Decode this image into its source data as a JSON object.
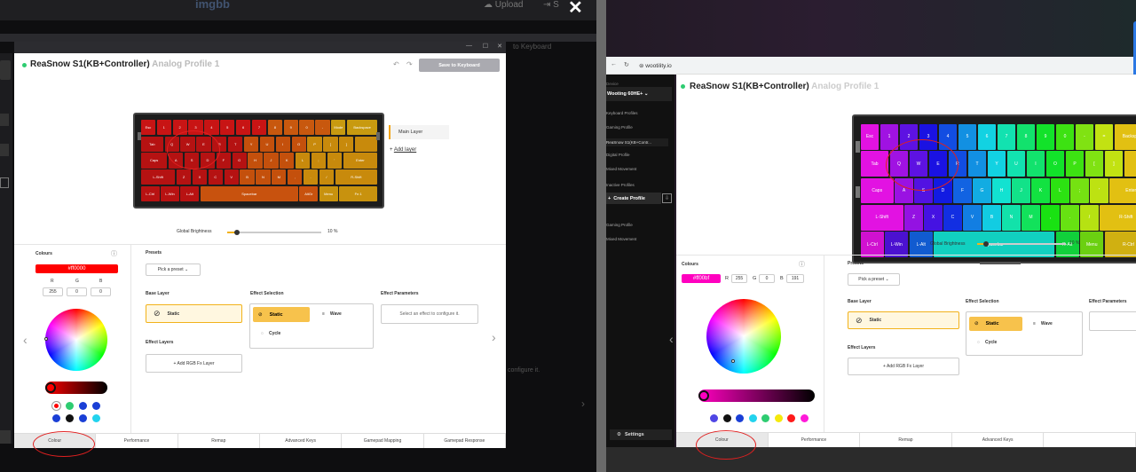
{
  "left": {
    "behind": {
      "logo": "imgbb",
      "upload": "Upload",
      "toKeyboard": "to Keyboard",
      "configure": "configure it."
    },
    "close_glyph": "✕",
    "window_controls": [
      "—",
      "☐",
      "✕"
    ],
    "header": {
      "device": "ReaSnow S1(KB+Controller)",
      "profile": "Analog Profile 1",
      "save_label": "Save to Keyboard"
    },
    "layers": {
      "main": "Main Layer",
      "add": "Add layer"
    },
    "brightness": {
      "label": "Global Brightness",
      "value": "10 %",
      "fraction": 0.1
    },
    "colours": {
      "title": "Colours",
      "hex": "#ff0000",
      "r_label": "R",
      "g_label": "G",
      "b_label": "B",
      "r": "255",
      "g": "0",
      "b": "0",
      "accent": "#ff0000"
    },
    "presets": {
      "title": "Presets",
      "pick": "Pick a preset"
    },
    "base_layer": {
      "title": "Base Layer",
      "static": "Static"
    },
    "effect_selection": {
      "title": "Effect Selection",
      "static": "Static",
      "wave": "Wave",
      "cycle": "Cycle"
    },
    "effect_parameters": {
      "title": "Effect Parameters",
      "hint": "Select an effect to configure it."
    },
    "effect_layers": {
      "title": "Effect Layers",
      "add": "+ Add RGB Fx Layer"
    },
    "tabs": [
      "Colour",
      "Performance",
      "Remap",
      "Advanced Keys",
      "Gamepad Mapping",
      "Gamepad Response"
    ],
    "swatches": [
      "#ff0000",
      "#2ecc71",
      "#1a3fd6",
      "#1a3fd6",
      "#1a3fd6",
      "#111111",
      "#1a3fd6",
      "#22d3ee"
    ],
    "keyboard": {
      "rows": [
        [
          "Esc",
          "1",
          "2",
          "3",
          "4",
          "5",
          "6",
          "7",
          "8",
          "9",
          "0",
          "-",
          "Mode",
          "Backspace"
        ],
        [
          "Tab",
          "Q",
          "W",
          "E",
          "R",
          "T",
          "Y",
          "U",
          "I",
          "O",
          "P",
          "[",
          "]",
          ""
        ],
        [
          "Caps",
          "A",
          "S",
          "D",
          "F",
          "G",
          "H",
          "J",
          "K",
          "L",
          ";",
          "'",
          "Enter"
        ],
        [
          "L-Shift",
          "Z",
          "X",
          "C",
          "V",
          "B",
          "N",
          "M",
          ",",
          ".",
          "/",
          "R-Shift"
        ],
        [
          "L-Ctrl",
          "L-Win",
          "L-Alt",
          "Spacebar",
          "AltGr",
          "Menu",
          "Fn 1"
        ]
      ]
    }
  },
  "right": {
    "url": "wootility.io",
    "header": {
      "device": "ReaSnow S1(KB+Controller)",
      "profile": "Analog Profile 1"
    },
    "sidebar": {
      "device": "Wooting 60HE+",
      "items": [
        "Keyboard Profiles",
        "Gaming Profile",
        "ReaSnow S1(KB+Contr...",
        "Digital Profile",
        "Mixed Movement",
        "Inactive Profiles",
        "Gaming Profile",
        "Mixed Movement"
      ],
      "create": "Create Profile",
      "settings": "Settings",
      "device_label": "Device"
    },
    "brightness": {
      "label": "Global Brightness",
      "value": "10 %",
      "fraction": 0.1
    },
    "colours": {
      "title": "Colours",
      "hex": "#ff00bf",
      "r_label": "R",
      "g_label": "G",
      "b_label": "B",
      "r": "255",
      "g": "0",
      "b": "191",
      "accent": "#ff00bf"
    },
    "presets": {
      "title": "Presets",
      "pick": "Pick a preset"
    },
    "base_layer": {
      "title": "Base Layer",
      "static": "Static"
    },
    "effect_selection": {
      "title": "Effect Selection",
      "static": "Static",
      "wave": "Wave",
      "cycle": "Cycle"
    },
    "effect_parameters": {
      "title": "Effect Parameters"
    },
    "effect_layers": {
      "title": "Effect Layers",
      "add": "+ Add RGB Fx Layer"
    },
    "tabs": [
      "Colour",
      "Performance",
      "Remap",
      "Advanced Keys",
      ""
    ],
    "swatches": [
      "#4f46e5",
      "#111111",
      "#1a3fd6",
      "#22d3ee",
      "#2ecc71",
      "#f5e90c",
      "#ff1a1a",
      "#ff1ad9"
    ],
    "keyboard": {
      "rows": [
        [
          "Esc",
          "1",
          "2",
          "3",
          "4",
          "5",
          "6",
          "7",
          "8",
          "9",
          "0",
          "-",
          "=",
          "Backspace"
        ],
        [
          "Tab",
          "Q",
          "W",
          "E",
          "R",
          "T",
          "Y",
          "U",
          "I",
          "O",
          "P",
          "[",
          "]",
          "\\"
        ],
        [
          "Caps",
          "A",
          "S",
          "D",
          "F",
          "G",
          "H",
          "J",
          "K",
          "L",
          ";",
          "'",
          "Enter"
        ],
        [
          "L-Shift",
          "Z",
          "X",
          "C",
          "V",
          "B",
          "N",
          "M",
          ",",
          ".",
          "/",
          "R-Shift"
        ],
        [
          "L-Ctrl",
          "L-Win",
          "L-Alt",
          "Spacebar",
          "R-Alt",
          "Menu",
          "R-Ctrl"
        ]
      ]
    }
  }
}
